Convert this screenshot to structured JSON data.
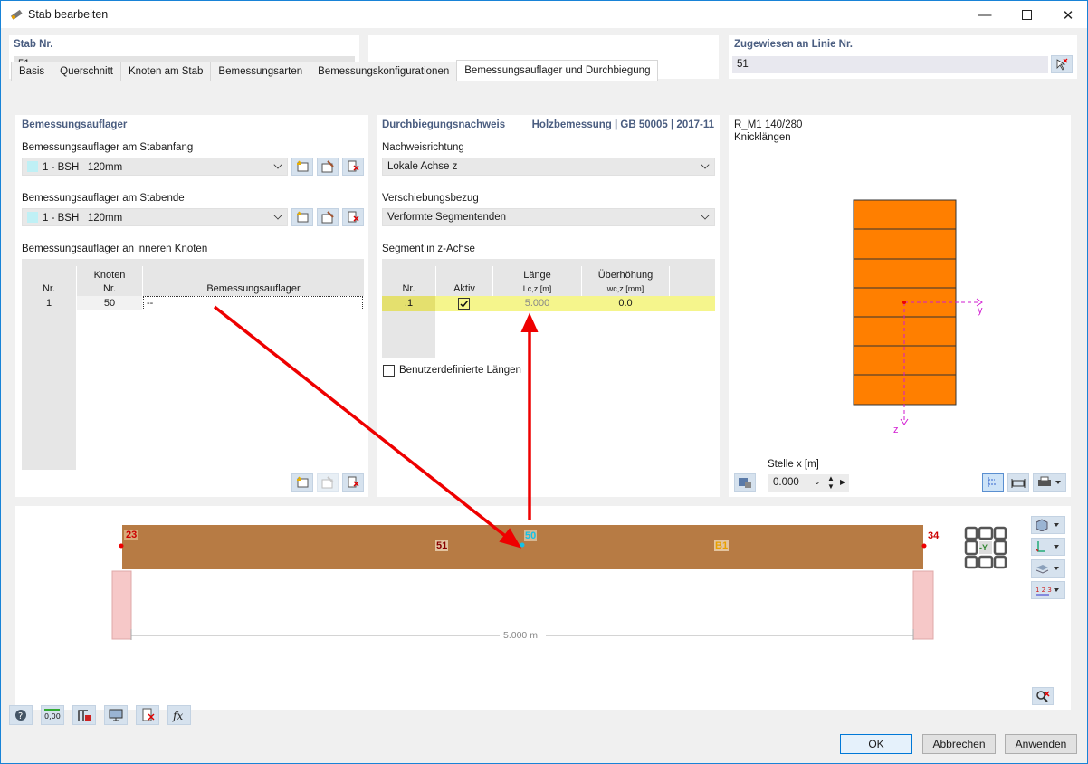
{
  "window": {
    "title": "Stab bearbeiten"
  },
  "header": {
    "stab_label": "Stab Nr.",
    "stab_value": "51",
    "linie_label": "Zugewiesen an Linie Nr.",
    "linie_value": "51"
  },
  "tabs": [
    "Basis",
    "Querschnitt",
    "Knoten am Stab",
    "Bemessungsarten",
    "Bemessungskonfigurationen",
    "Bemessungsauflager und Durchbiegung"
  ],
  "active_tab": "Bemessungsauflager und Durchbiegung",
  "left": {
    "title": "Bemessungsauflager",
    "start_label": "Bemessungsauflager am Stabanfang",
    "start_value_id": "1 - BSH",
    "start_value": "120mm",
    "end_label": "Bemessungsauflager am Stabende",
    "end_value_id": "1 - BSH",
    "end_value": "120mm",
    "inner_label": "Bemessungsauflager an inneren Knoten",
    "table": {
      "h_nr": "Nr.",
      "h_knoten_1": "Knoten",
      "h_knoten_2": "Nr.",
      "h_auflager": "Bemessungsauflager",
      "rows": [
        {
          "nr": "1",
          "knoten": "50",
          "auflager": "--"
        }
      ]
    }
  },
  "middle": {
    "title": "Durchbiegungsnachweis",
    "standard": "Holzbemessung | GB 50005 | 2017-11",
    "richtung_label": "Nachweisrichtung",
    "richtung_value": "Lokale Achse z",
    "bezug_label": "Verschiebungsbezug",
    "bezug_value": "Verformte Segmentenden",
    "segment_label": "Segment in z-Achse",
    "table": {
      "h_nr": "Nr.",
      "h_aktiv": "Aktiv",
      "h_laenge": "Länge",
      "h_laenge_sub": "Lc,z [m]",
      "h_ueber": "Überhöhung",
      "h_ueber_sub": "wc,z [mm]",
      "rows": [
        {
          "nr": ".1",
          "aktiv": true,
          "laenge": "5.000",
          "ueber": "0.0"
        }
      ]
    },
    "custom_label": "Benutzerdefinierte Längen"
  },
  "right": {
    "section_name": "R_M1 140/280",
    "subtitle": "Knicklängen",
    "axis_y": "y",
    "axis_z": "z",
    "stelle_label": "Stelle x [m]",
    "stelle_value": "0.000"
  },
  "beam_view": {
    "node_start": "23",
    "node_end": "34",
    "member": "51",
    "inner_node": "50",
    "b1": "B1",
    "length": "5.000 m",
    "view_label": "-Y"
  },
  "buttons": {
    "ok": "OK",
    "cancel": "Abbrechen",
    "apply": "Anwenden"
  },
  "colors": {
    "beam": "#b77b44",
    "section": "#ff7f00",
    "highlight": "#f5f58c",
    "arrow": "#ee0000",
    "axis": "#d21bd2"
  }
}
